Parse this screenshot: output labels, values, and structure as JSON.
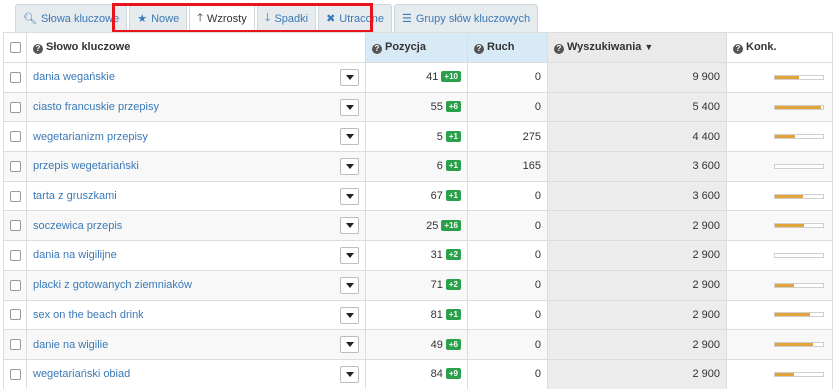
{
  "tabs": [
    {
      "icon": "search-icon",
      "glyph": "🔍︎",
      "label": "Słowa kluczowe",
      "active": false
    },
    {
      "icon": "star-icon",
      "glyph": "★",
      "label": "Nowe",
      "active": false
    },
    {
      "icon": "arrow-up-icon",
      "glyph": "🡑",
      "label": "Wzrosty",
      "active": true
    },
    {
      "icon": "arrow-down-icon",
      "glyph": "🡓",
      "label": "Spadki",
      "active": false
    },
    {
      "icon": "close-icon",
      "glyph": "✖",
      "label": "Utracone",
      "active": false
    },
    {
      "icon": "list-icon",
      "glyph": "☰",
      "label": "Grupy słów kluczowych",
      "active": false
    }
  ],
  "columns": {
    "keyword": "Słowo kluczowe",
    "position": "Pozycja",
    "traffic": "Ruch",
    "searches": "Wyszukiwania",
    "competition": "Konk."
  },
  "rows": [
    {
      "keyword": "dania wegańskie",
      "position": "41",
      "change": "+10",
      "traffic": "0",
      "searches": "9 900",
      "competition": 0.5
    },
    {
      "keyword": "ciasto francuskie przepisy",
      "position": "55",
      "change": "+6",
      "traffic": "0",
      "searches": "5 400",
      "competition": 0.95
    },
    {
      "keyword": "wegetarianizm przepisy",
      "position": "5",
      "change": "+1",
      "traffic": "275",
      "searches": "4 400",
      "competition": 0.42
    },
    {
      "keyword": "przepis wegetariański",
      "position": "6",
      "change": "+1",
      "traffic": "165",
      "searches": "3 600",
      "competition": 0
    },
    {
      "keyword": "tarta z gruszkami",
      "position": "67",
      "change": "+1",
      "traffic": "0",
      "searches": "3 600",
      "competition": 0.58
    },
    {
      "keyword": "soczewica przepis",
      "position": "25",
      "change": "+16",
      "traffic": "0",
      "searches": "2 900",
      "competition": 0.6
    },
    {
      "keyword": "dania na wigilijne",
      "position": "31",
      "change": "+2",
      "traffic": "0",
      "searches": "2 900",
      "competition": 0
    },
    {
      "keyword": "placki z gotowanych ziemniaków",
      "position": "71",
      "change": "+2",
      "traffic": "0",
      "searches": "2 900",
      "competition": 0.4
    },
    {
      "keyword": "sex on the beach drink",
      "position": "81",
      "change": "+1",
      "traffic": "0",
      "searches": "2 900",
      "competition": 0.72
    },
    {
      "keyword": "danie na wigilie",
      "position": "49",
      "change": "+6",
      "traffic": "0",
      "searches": "2 900",
      "competition": 0.8
    },
    {
      "keyword": "wegetariański obiad",
      "position": "84",
      "change": "+9",
      "traffic": "0",
      "searches": "2 900",
      "competition": 0.4
    }
  ],
  "colors": {
    "link": "#3a7ab8",
    "badge": "#2aa04a",
    "bar": "#e3a33b",
    "highlight": "#e8141c"
  }
}
